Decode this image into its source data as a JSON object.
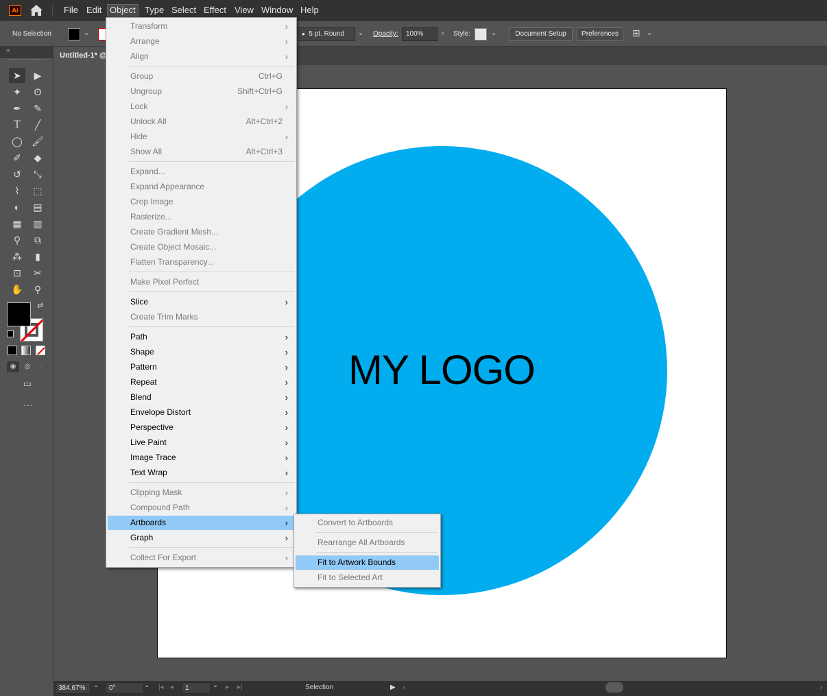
{
  "app": {
    "logo_text": "Ai",
    "menu": [
      "File",
      "Edit",
      "Object",
      "Type",
      "Select",
      "Effect",
      "View",
      "Window",
      "Help"
    ],
    "active_menu": "Object"
  },
  "controlbar": {
    "selection_status": "No Selection",
    "stroke_profile": "5 pt. Round",
    "opacity_label": "Opacity:",
    "opacity_value": "100%",
    "style_label": "Style:",
    "document_setup": "Document Setup",
    "preferences": "Preferences"
  },
  "document": {
    "tab_title": "Untitled-1* @"
  },
  "artwork": {
    "logo_text": "MY LOGO",
    "circle_color": "#01adee"
  },
  "object_menu": [
    {
      "label": "Transform",
      "submenu": true,
      "disabled": true
    },
    {
      "label": "Arrange",
      "submenu": true,
      "disabled": true
    },
    {
      "label": "Align",
      "submenu": true,
      "disabled": true
    },
    {
      "label": "Group",
      "shortcut": "Ctrl+G",
      "disabled": true
    },
    {
      "label": "Ungroup",
      "shortcut": "Shift+Ctrl+G",
      "disabled": true
    },
    {
      "label": "Lock",
      "submenu": true,
      "disabled": true
    },
    {
      "label": "Unlock All",
      "shortcut": "Alt+Ctrl+2",
      "disabled": true
    },
    {
      "label": "Hide",
      "submenu": true,
      "disabled": true
    },
    {
      "label": "Show All",
      "shortcut": "Alt+Ctrl+3",
      "disabled": true
    },
    {
      "label": "Expand...",
      "disabled": true
    },
    {
      "label": "Expand Appearance",
      "disabled": true
    },
    {
      "label": "Crop Image",
      "disabled": true
    },
    {
      "label": "Rasterize...",
      "disabled": true
    },
    {
      "label": "Create Gradient Mesh...",
      "disabled": true
    },
    {
      "label": "Create Object Mosaic...",
      "disabled": true
    },
    {
      "label": "Flatten Transparency...",
      "disabled": true
    },
    {
      "label": "Make Pixel Perfect",
      "disabled": true
    },
    {
      "label": "Slice",
      "submenu": true
    },
    {
      "label": "Create Trim Marks",
      "disabled": true
    },
    {
      "label": "Path",
      "submenu": true
    },
    {
      "label": "Shape",
      "submenu": true
    },
    {
      "label": "Pattern",
      "submenu": true
    },
    {
      "label": "Repeat",
      "submenu": true
    },
    {
      "label": "Blend",
      "submenu": true
    },
    {
      "label": "Envelope Distort",
      "submenu": true
    },
    {
      "label": "Perspective",
      "submenu": true
    },
    {
      "label": "Live Paint",
      "submenu": true
    },
    {
      "label": "Image Trace",
      "submenu": true
    },
    {
      "label": "Text Wrap",
      "submenu": true
    },
    {
      "label": "Clipping Mask",
      "submenu": true,
      "disabled": true
    },
    {
      "label": "Compound Path",
      "submenu": true,
      "disabled": true
    },
    {
      "label": "Artboards",
      "submenu": true,
      "highlighted": true
    },
    {
      "label": "Graph",
      "submenu": true
    },
    {
      "label": "Collect For Export",
      "submenu": true,
      "disabled": true
    }
  ],
  "artboards_submenu": [
    {
      "label": "Convert to Artboards",
      "disabled": true
    },
    {
      "label": "Rearrange All Artboards",
      "disabled": true
    },
    {
      "label": "Fit to Artwork Bounds",
      "highlighted": true
    },
    {
      "label": "Fit to Selected Art",
      "disabled": true
    }
  ],
  "statusbar": {
    "zoom": "384.67%",
    "rotation": "0°",
    "artboard_number": "1",
    "tool_name": "Selection"
  }
}
